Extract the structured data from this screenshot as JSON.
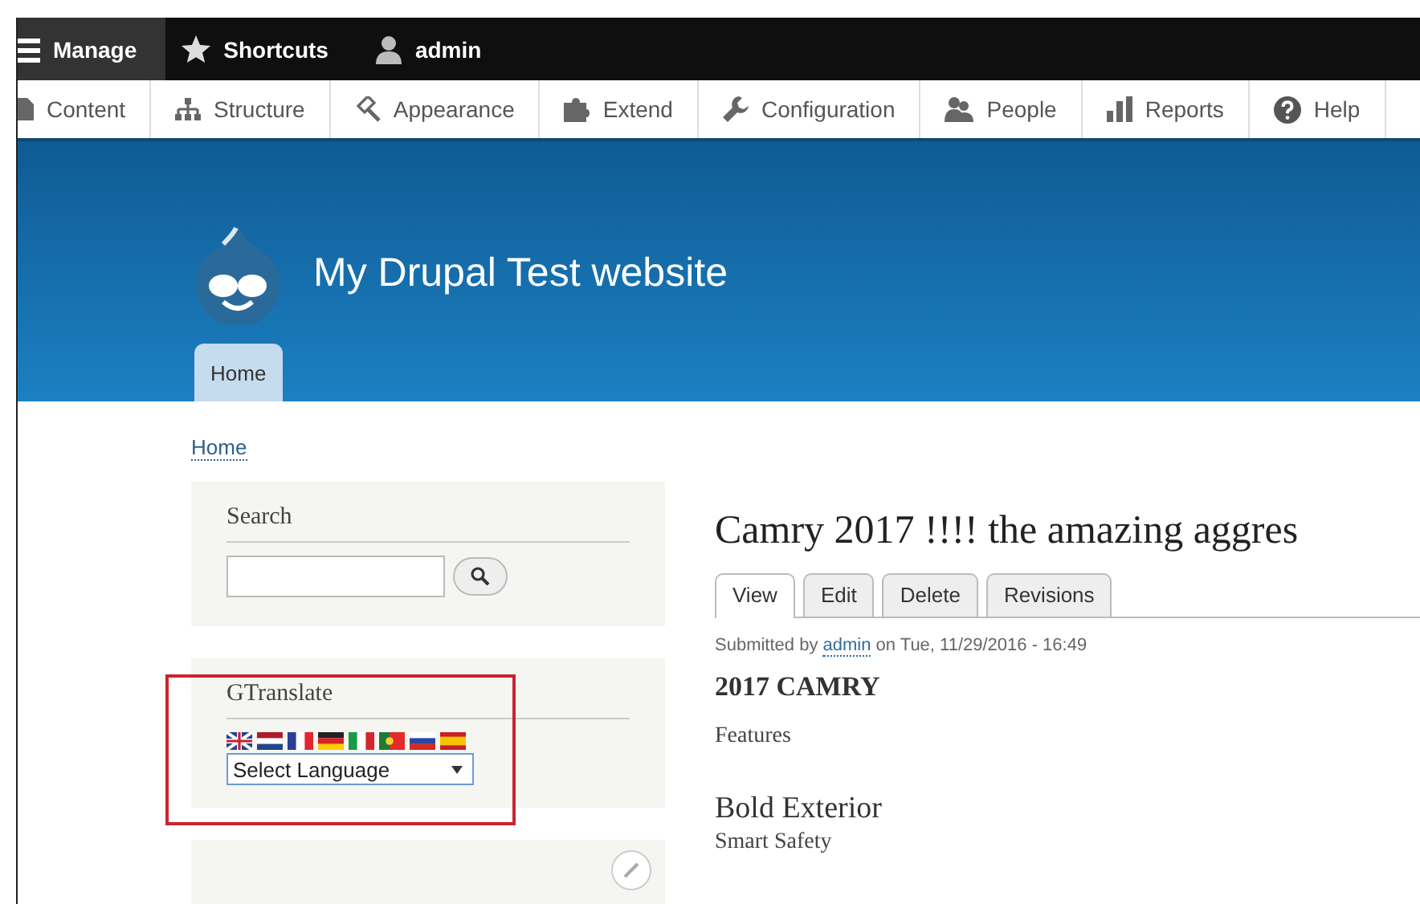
{
  "toolbar": {
    "items": [
      {
        "label": "Manage",
        "selected": true
      },
      {
        "label": "Shortcuts",
        "selected": false
      },
      {
        "label": "admin",
        "selected": false
      }
    ]
  },
  "tray": {
    "items": [
      {
        "label": "Content"
      },
      {
        "label": "Structure"
      },
      {
        "label": "Appearance"
      },
      {
        "label": "Extend"
      },
      {
        "label": "Configuration"
      },
      {
        "label": "People"
      },
      {
        "label": "Reports"
      },
      {
        "label": "Help"
      }
    ]
  },
  "header": {
    "site_name": "My Drupal Test website",
    "nav": [
      {
        "label": "Home",
        "selected": true
      }
    ]
  },
  "breadcrumb": [
    "Home"
  ],
  "sidebar": {
    "blocks": [
      {
        "kind": "search",
        "title": "Search"
      },
      {
        "kind": "gtranslate",
        "title": "GTranslate",
        "select": "Select Language",
        "highlighted": true
      },
      {
        "kind": "cut"
      }
    ]
  },
  "main": {
    "title": "Camry 2017 !!!! the amazing aggres",
    "tabs": [
      {
        "label": "View",
        "selected": true
      },
      {
        "label": "Edit",
        "selected": false
      },
      {
        "label": "Delete",
        "selected": false
      },
      {
        "label": "Revisions",
        "selected": false
      }
    ],
    "submitted": {
      "prefix": "Submitted by",
      "author": "admin",
      "suffix": "on Tue, 11/29/2016 - 16:49"
    },
    "body": [
      {
        "kind": "heading",
        "text": "2017 CAMRY"
      },
      {
        "kind": "paragraph",
        "text": "Features"
      },
      {
        "kind": "subheading",
        "text": "Bold Exterior"
      },
      {
        "kind": "line",
        "text": "Smart Safety"
      }
    ]
  }
}
